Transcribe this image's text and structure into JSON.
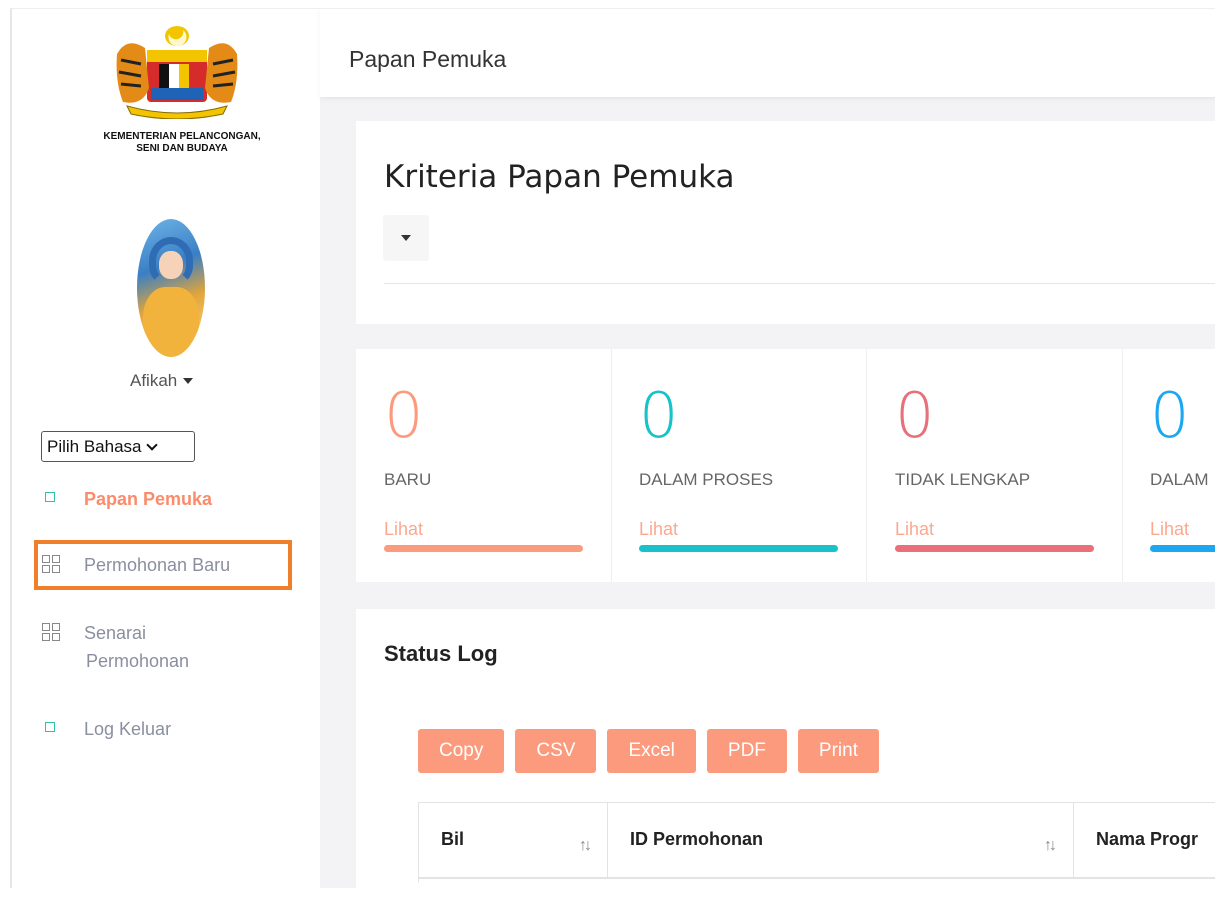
{
  "sidebar": {
    "ministry_line1": "KEMENTERIAN PELANCONGAN,",
    "ministry_line2": "SENI DAN BUDAYA",
    "username": "Afikah",
    "language_select": "Pilih Bahasa",
    "items": [
      {
        "label": "Papan Pemuka",
        "icon": "square-icon",
        "active": true
      },
      {
        "label": "Permohonan Baru",
        "icon": "grid-icon",
        "active": false,
        "highlighted": true
      },
      {
        "label": "Senarai",
        "label2": "Permohonan",
        "icon": "grid-icon",
        "active": false
      },
      {
        "label": "Log Keluar",
        "icon": "square-icon",
        "active": false
      }
    ]
  },
  "header": {
    "title": "Papan Pemuka"
  },
  "criteria": {
    "title": "Kriteria Papan Pemuka"
  },
  "stats": [
    {
      "value": "0",
      "label": "BARU",
      "link": "Lihat",
      "color": "#fb9a7c"
    },
    {
      "value": "0",
      "label": "DALAM PROSES",
      "link": "Lihat",
      "color": "#17c3c9"
    },
    {
      "value": "0",
      "label": "TIDAK LENGKAP",
      "link": "Lihat",
      "color": "#e8707a"
    },
    {
      "value": "0",
      "label": "DALAM",
      "link": "Lihat",
      "color": "#1ba8f0"
    }
  ],
  "status_log": {
    "title": "Status Log",
    "buttons": [
      "Copy",
      "CSV",
      "Excel",
      "PDF",
      "Print"
    ],
    "columns": [
      "Bil",
      "ID Permohonan",
      "Nama Progr"
    ],
    "sort_glyph": "↑↓"
  },
  "colors": {
    "accent": "#fb8c6b",
    "highlight_border": "#f07f2c",
    "nav_icon": "#2ec4a1"
  }
}
